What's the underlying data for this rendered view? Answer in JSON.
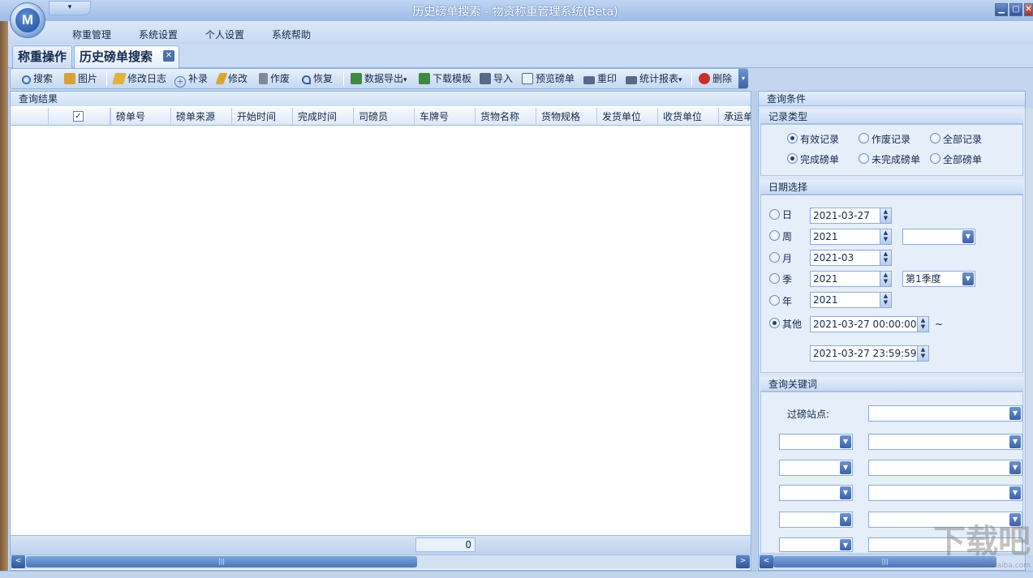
{
  "window": {
    "title": "历史磅单搜索 - 物资称重管理系统(Beta)",
    "app_logo": "M",
    "qat_glyph": "▾",
    "controls": {
      "minimize": "▁",
      "maximize": "▢",
      "close": "✕"
    }
  },
  "menu": [
    "称重管理",
    "系统设置",
    "个人设置",
    "系统帮助"
  ],
  "tabs": [
    {
      "label": "称重操作",
      "active": false
    },
    {
      "label": "历史磅单搜索",
      "active": true,
      "close": "✕"
    }
  ],
  "toolbar": {
    "items": [
      {
        "label": "搜索",
        "icon": "search-icon",
        "color": "#3f6fb5"
      },
      {
        "label": "图片",
        "icon": "image-icon",
        "color": "#d8a23a"
      },
      {
        "label": "修改日志",
        "icon": "edit-log-icon",
        "color": "#e0b13c"
      },
      {
        "label": "补录",
        "icon": "add-icon",
        "color": "#4d79b9"
      },
      {
        "label": "修改",
        "icon": "pencil-icon",
        "color": "#d9a531"
      },
      {
        "label": "作废",
        "icon": "trash-icon",
        "color": "#7d8a9c"
      },
      {
        "label": "恢复",
        "icon": "undo-icon",
        "color": "#2f63a8"
      },
      {
        "label": "数据导出",
        "icon": "excel-export-icon",
        "color": "#3e8a3e",
        "dropdown": "▾"
      },
      {
        "label": "下载模板",
        "icon": "excel-template-icon",
        "color": "#3e8a3e"
      },
      {
        "label": "导入",
        "icon": "save-icon",
        "color": "#56698a"
      },
      {
        "label": "预览磅单",
        "icon": "preview-icon",
        "color": "#56698a"
      },
      {
        "label": "重印",
        "icon": "printer-icon",
        "color": "#56698a"
      },
      {
        "label": "统计报表",
        "icon": "report-printer-icon",
        "color": "#56698a",
        "dropdown": "▾"
      },
      {
        "label": "删除",
        "icon": "delete-icon",
        "color": "#c72f2f"
      }
    ],
    "more_glyph": "▾"
  },
  "results": {
    "title": "查询结果",
    "checkbox_glyph": "✓",
    "columns": [
      "磅单号",
      "磅单来源",
      "开始时间",
      "完成时间",
      "司磅员",
      "车牌号",
      "货物名称",
      "货物规格",
      "发货单位",
      "收货单位",
      "承运单"
    ],
    "row_count": "0",
    "scroll_left": "<",
    "scroll_right": ">",
    "scroll_grip": "|||"
  },
  "conditions": {
    "title": "查询条件",
    "record_type": {
      "title": "记录类型",
      "options": [
        {
          "label": "有效记录",
          "checked": true
        },
        {
          "label": "作废记录",
          "checked": false
        },
        {
          "label": "全部记录",
          "checked": false
        },
        {
          "label": "完成磅单",
          "checked": true
        },
        {
          "label": "未完成磅单",
          "checked": false
        },
        {
          "label": "全部磅单",
          "checked": false
        }
      ]
    },
    "date": {
      "title": "日期选择",
      "day": {
        "label": "日",
        "value": "2021-03-27",
        "checked": false
      },
      "week": {
        "label": "周",
        "value": "2021",
        "extra": "",
        "checked": false
      },
      "month": {
        "label": "月",
        "value": "2021-03",
        "checked": false
      },
      "quarter": {
        "label": "季",
        "value": "2021",
        "extra": "第1季度",
        "checked": false
      },
      "year": {
        "label": "年",
        "value": "2021",
        "checked": false
      },
      "other": {
        "label": "其他",
        "from": "2021-03-27 00:00:00",
        "to": "2021-03-27 23:59:59",
        "tilde": "~",
        "checked": true
      }
    },
    "keywords": {
      "title": "查询关键词",
      "station_label": "过磅站点:"
    }
  },
  "watermark": {
    "text": "下载吧",
    "url": "www.xiazaiba.com"
  }
}
